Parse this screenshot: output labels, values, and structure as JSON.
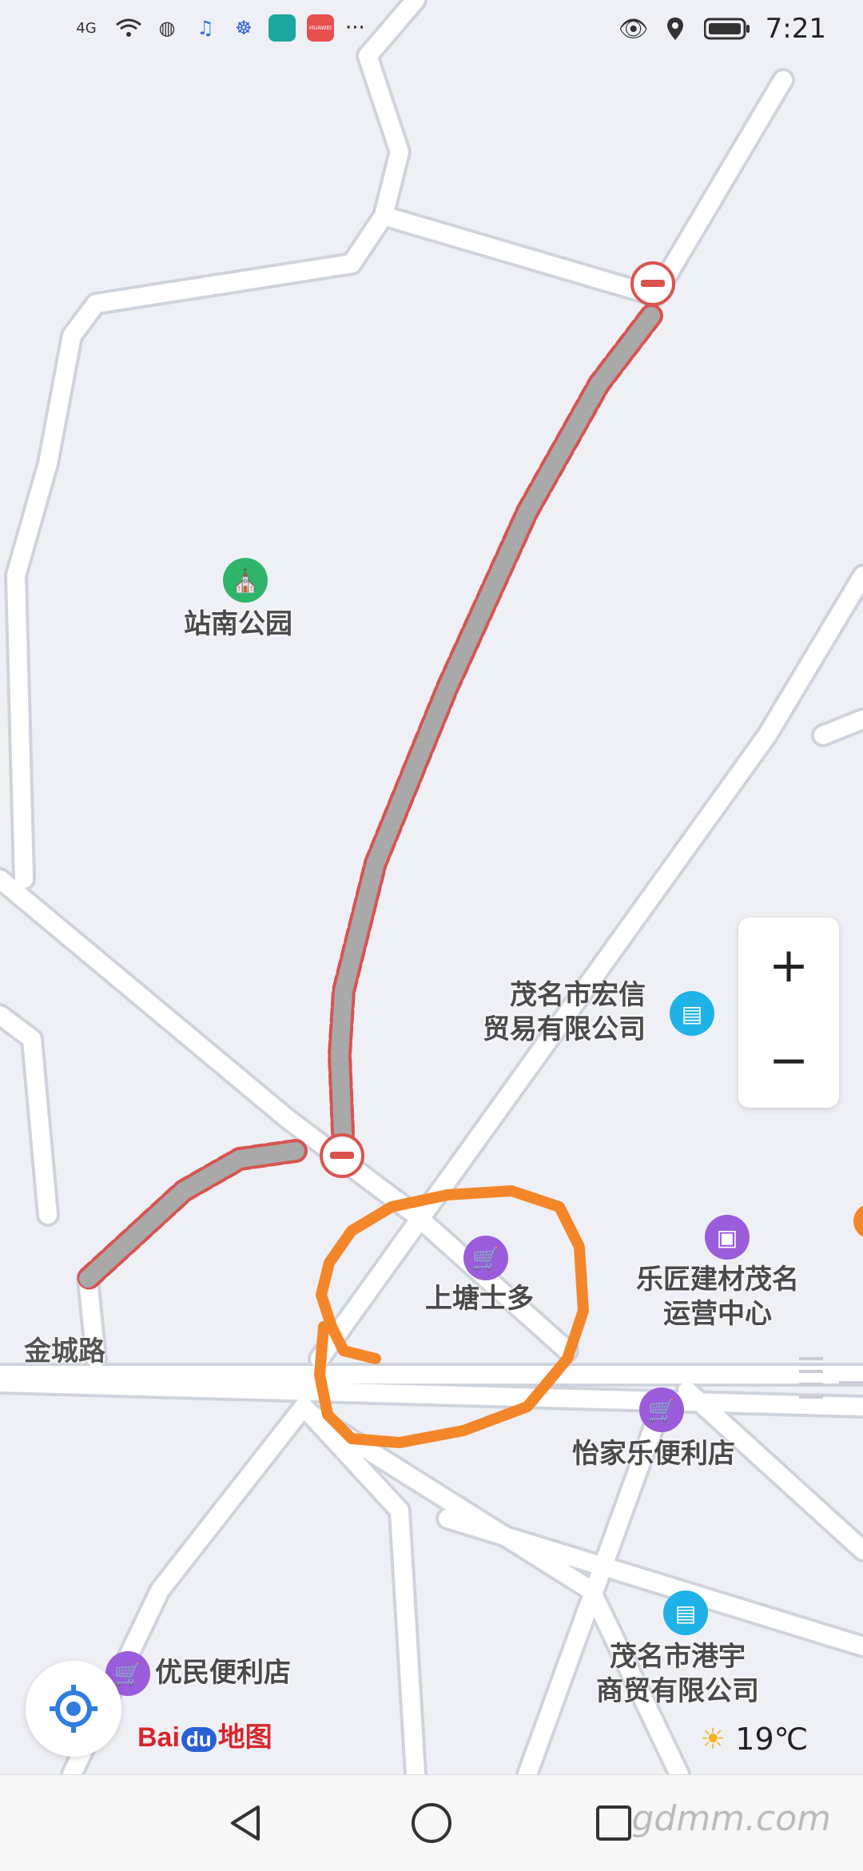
{
  "status_bar": {
    "network": "4G",
    "time": "7:21",
    "more": "···",
    "app_chips": [
      {
        "name": "camel-app",
        "color": "#19a7a0",
        "text": ""
      },
      {
        "name": "huawei-app",
        "color": "#e84f4f",
        "text": "HUAWEI"
      }
    ]
  },
  "map": {
    "park_label": "站南公园",
    "road_label": "金城路",
    "pois": [
      {
        "name": "茂名市宏信\n贸易有限公司",
        "type": "building"
      },
      {
        "name": "上塘士多",
        "type": "shop"
      },
      {
        "name": "乐匠建材茂名\n运营中心",
        "type": "mall"
      },
      {
        "name": "怡家乐便利店",
        "type": "shop"
      },
      {
        "name": "茂名市港宇\n商贸有限公司",
        "type": "building"
      },
      {
        "name": "优民便利店",
        "type": "shop"
      }
    ],
    "colors": {
      "road": "#ffffff",
      "road_edge": "#cfd3dc",
      "closed_road_fill": "#a9a9a9",
      "closed_road_dash": "#d9534f",
      "annotation_circle": "#f4862a",
      "poi_purple": "#9b5cdc",
      "poi_teal": "#1fb2e6",
      "park_green": "#2fb56a"
    }
  },
  "controls": {
    "zoom_in": "+",
    "zoom_out": "−"
  },
  "branding": {
    "logo_text": "Bai地图",
    "logo_bai": "Bai",
    "logo_du": "du",
    "logo_map": "地图"
  },
  "weather": {
    "temperature": "19℃"
  },
  "navigation": {
    "back": "back",
    "home": "home",
    "recents": "recents"
  },
  "watermark": "gdmm.com"
}
